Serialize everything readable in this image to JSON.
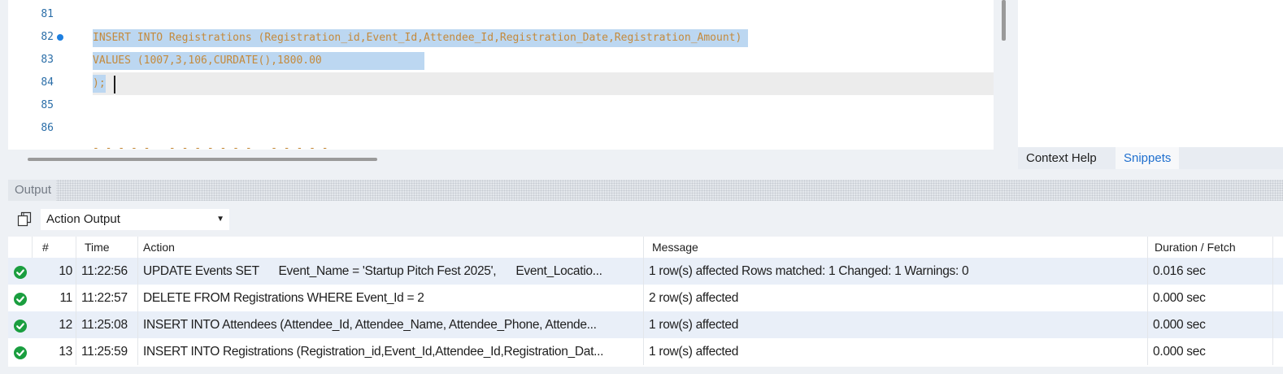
{
  "editor": {
    "lines": [
      {
        "number": "81",
        "text": ""
      },
      {
        "number": "82",
        "text": "INSERT INTO Registrations (Registration_id,Event_Id,Attendee_Id,Registration_Date,Registration_Amount)"
      },
      {
        "number": "83",
        "text": "VALUES (1007,3,106,CURDATE(),1800.00"
      },
      {
        "number": "84",
        "text": ");"
      },
      {
        "number": "85",
        "text": ""
      },
      {
        "number": "86",
        "text": ""
      }
    ],
    "cutoff_text": "- - - - -  .  - - - - - - -  . - - - - -"
  },
  "side_panel": {
    "tabs": [
      "Context Help",
      "Snippets"
    ],
    "active_tab": "Snippets"
  },
  "output": {
    "title": "Output",
    "selector_value": "Action Output",
    "columns": [
      "#",
      "Time",
      "Action",
      "Message",
      "Duration / Fetch"
    ],
    "rows": [
      {
        "num": "10",
        "time": "11:22:56",
        "action": "UPDATE Events SET      Event_Name = 'Startup Pitch Fest 2025',      Event_Locatio...",
        "message": "1 row(s) affected Rows matched: 1  Changed: 1  Warnings: 0",
        "duration": "0.016 sec",
        "status": "success"
      },
      {
        "num": "11",
        "time": "11:22:57",
        "action": "DELETE FROM Registrations WHERE Event_Id = 2",
        "message": "2 row(s) affected",
        "duration": "0.000 sec",
        "status": "success"
      },
      {
        "num": "12",
        "time": "11:25:08",
        "action": "INSERT INTO Attendees (Attendee_Id, Attendee_Name, Attendee_Phone, Attende...",
        "message": "1 row(s) affected",
        "duration": "0.000 sec",
        "status": "success"
      },
      {
        "num": "13",
        "time": "11:25:59",
        "action": "INSERT INTO Registrations (Registration_id,Event_Id,Attendee_Id,Registration_Dat...",
        "message": "1 row(s) affected",
        "duration": "0.000 sec",
        "status": "success"
      }
    ]
  },
  "colors": {
    "selection": "#bcd7f1",
    "code_text": "#c48a3c",
    "line_number": "#2b6ea8",
    "success": "#1a9e3f",
    "alt_row": "#e9eff8",
    "active_tab": "#1f6fce"
  }
}
